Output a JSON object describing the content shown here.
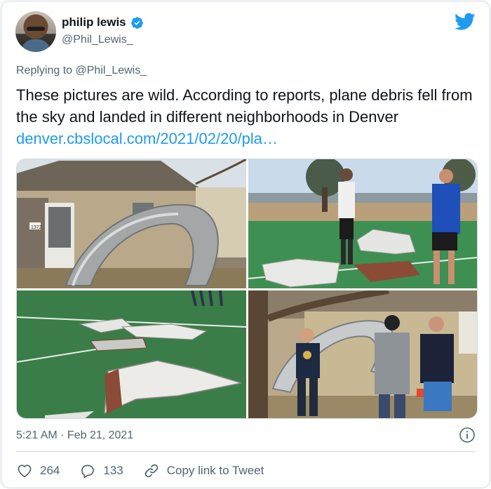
{
  "author": {
    "display_name": "philip lewis",
    "handle": "@Phil_Lewis_"
  },
  "reply": {
    "prefix": "Replying to ",
    "to": "@Phil_Lewis_"
  },
  "tweet": {
    "text": "These pictures are wild. According to reports, plane debris fell from the sky and landed in different neighborhoods in Denver ",
    "link": "denver.cbslocal.com/2021/02/20/pla…"
  },
  "timestamp": "5:21 AM · Feb 21, 2021",
  "actions": {
    "likes": "264",
    "replies": "133",
    "copy_link": "Copy link to Tweet"
  },
  "house_number": "1372",
  "colors": {
    "accent": "#1d9bf0",
    "secondary_text": "#536471",
    "border": "#cfd9de"
  },
  "icons": [
    "verified-badge-icon",
    "twitter-bird-icon",
    "info-icon",
    "heart-icon",
    "reply-bubble-icon",
    "link-icon"
  ]
}
